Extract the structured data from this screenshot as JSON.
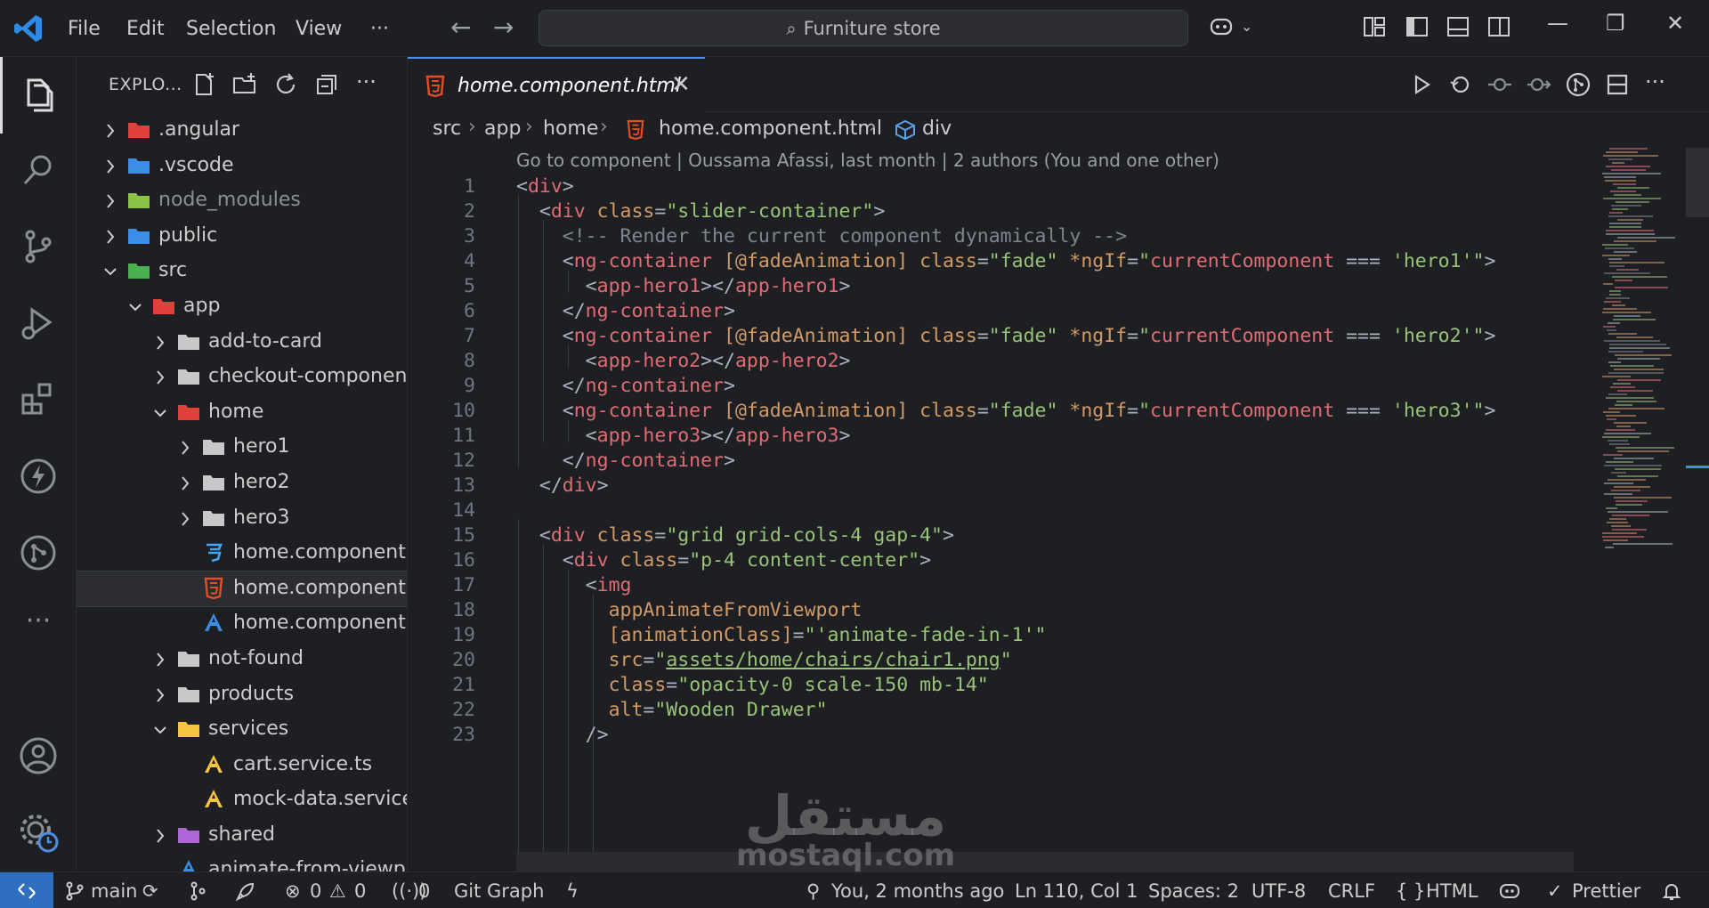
{
  "menu": {
    "file": "File",
    "edit": "Edit",
    "selection": "Selection",
    "view": "View",
    "more": "···"
  },
  "search": {
    "text": "Furniture store"
  },
  "sidebar": {
    "title": "EXPLO...",
    "items": [
      {
        "label": ".angular",
        "depth": 0,
        "kind": "folder",
        "expanded": false,
        "icon": "angular-folder-icon",
        "color": "#e0413a"
      },
      {
        "label": ".vscode",
        "depth": 0,
        "kind": "folder",
        "expanded": false,
        "icon": "vscode-folder-icon",
        "color": "#3a8ee6"
      },
      {
        "label": "node_modules",
        "depth": 0,
        "kind": "folder",
        "expanded": false,
        "icon": "node-folder-icon",
        "color": "#8bc34a",
        "dim": true
      },
      {
        "label": "public",
        "depth": 0,
        "kind": "folder",
        "expanded": false,
        "icon": "public-folder-icon",
        "color": "#3a8ee6"
      },
      {
        "label": "src",
        "depth": 0,
        "kind": "folder",
        "expanded": true,
        "icon": "src-folder-icon",
        "color": "#4caf50"
      },
      {
        "label": "app",
        "depth": 1,
        "kind": "folder",
        "expanded": true,
        "icon": "app-folder-icon",
        "color": "#e0413a"
      },
      {
        "label": "add-to-card",
        "depth": 2,
        "kind": "folder",
        "expanded": false,
        "icon": "folder-icon",
        "color": "#c8c8c8"
      },
      {
        "label": "checkout-component",
        "depth": 2,
        "kind": "folder",
        "expanded": false,
        "icon": "folder-icon",
        "color": "#c8c8c8"
      },
      {
        "label": "home",
        "depth": 2,
        "kind": "folder",
        "expanded": true,
        "icon": "home-folder-icon",
        "color": "#e0413a"
      },
      {
        "label": "hero1",
        "depth": 3,
        "kind": "folder",
        "expanded": false,
        "icon": "folder-icon",
        "color": "#c8c8c8"
      },
      {
        "label": "hero2",
        "depth": 3,
        "kind": "folder",
        "expanded": false,
        "icon": "folder-icon",
        "color": "#c8c8c8"
      },
      {
        "label": "hero3",
        "depth": 3,
        "kind": "folder",
        "expanded": false,
        "icon": "folder-icon",
        "color": "#c8c8c8"
      },
      {
        "label": "home.component.css",
        "depth": 3,
        "kind": "file",
        "icon": "css-file-icon",
        "color": "#42a5f5"
      },
      {
        "label": "home.component.ht...",
        "depth": 3,
        "kind": "file",
        "icon": "html-file-icon",
        "color": "#e44d26",
        "selected": true
      },
      {
        "label": "home.component.ts",
        "depth": 3,
        "kind": "file",
        "icon": "angular-file-icon",
        "color": "#3a8ee6"
      },
      {
        "label": "not-found",
        "depth": 2,
        "kind": "folder",
        "expanded": false,
        "icon": "folder-icon",
        "color": "#c8c8c8"
      },
      {
        "label": "products",
        "depth": 2,
        "kind": "folder",
        "expanded": false,
        "icon": "folder-icon",
        "color": "#c8c8c8"
      },
      {
        "label": "services",
        "depth": 2,
        "kind": "folder",
        "expanded": true,
        "icon": "services-folder-icon",
        "color": "#f5c542"
      },
      {
        "label": "cart.service.ts",
        "depth": 3,
        "kind": "file",
        "icon": "service-file-icon",
        "color": "#f5c542"
      },
      {
        "label": "mock-data.service.ts",
        "depth": 3,
        "kind": "file",
        "icon": "service-file-icon",
        "color": "#f5c542"
      },
      {
        "label": "shared",
        "depth": 2,
        "kind": "folder",
        "expanded": false,
        "icon": "shared-folder-icon",
        "color": "#b065d6"
      },
      {
        "label": "animate-from-viewp...",
        "depth": 2,
        "kind": "file",
        "icon": "angular-file-icon",
        "color": "#3a8ee6"
      }
    ]
  },
  "tab": {
    "label": "home.component.html",
    "close": "✕"
  },
  "breadcrumb": {
    "src": "src",
    "app": "app",
    "home": "home",
    "file": "home.component.html",
    "symbol": "div"
  },
  "codelens": "Go to component | Oussama Afassi, last month | 2 authors (You and one other)",
  "code": {
    "line_numbers": [
      "1",
      "2",
      "3",
      "4",
      "5",
      "6",
      "7",
      "8",
      "9",
      "10",
      "11",
      "12",
      "13",
      "14",
      "15",
      "16",
      "17",
      "18",
      "19",
      "20",
      "21",
      "22",
      "23"
    ]
  },
  "statusbar": {
    "branch": "main",
    "errors": "0",
    "warnings": "0",
    "ports": "0",
    "git_graph": "Git Graph",
    "blame": "You, 2 months ago",
    "position": "Ln 110, Col 1",
    "spaces": "Spaces: 2",
    "encoding": "UTF-8",
    "eol": "CRLF",
    "language": "HTML",
    "formatter": "Prettier"
  },
  "watermark": {
    "arabic": "مستقل",
    "latin": "mostaql.com"
  },
  "colors": {
    "accent": "#4d8fe6",
    "tag": "#e06c75",
    "attr": "#d19a66",
    "string": "#98c379",
    "comment": "#7f848e"
  }
}
